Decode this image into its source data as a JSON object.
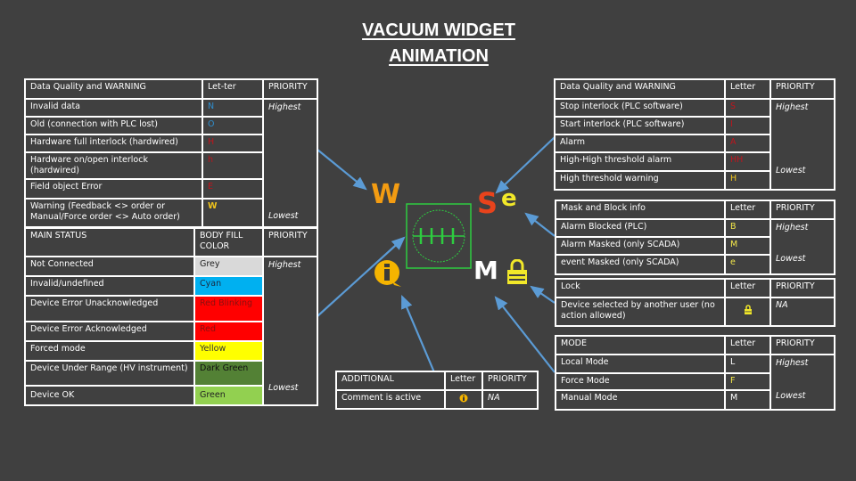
{
  "title_line1": "VACUUM WIDGET",
  "title_line2": "ANIMATION",
  "data_quality_left": {
    "headers": [
      "Data Quality and WARNING",
      "Let-ter",
      "PRIORITY"
    ],
    "priority_high": "Highest",
    "priority_low": "Lowest",
    "rows": [
      {
        "label": "Invalid data",
        "letter": "N",
        "color": "#2f8fcf"
      },
      {
        "label": "Old (connection with PLC lost)",
        "letter": "O",
        "color": "#2f8fcf"
      },
      {
        "label": "Hardware full interlock (hardwired)",
        "letter": "H",
        "color": "#c0141c"
      },
      {
        "label": "Hardware on/open interlock (hardwired)",
        "letter": "h",
        "color": "#c0141c"
      },
      {
        "label": "Field object Error",
        "letter": "E",
        "color": "#c0141c"
      },
      {
        "label": "Warning (Feedback <> order or Manual/Force order <> Auto order)",
        "letter": "W",
        "color": "#f0c41c"
      }
    ]
  },
  "main_status": {
    "headers": [
      "MAIN STATUS",
      "BODY FILL COLOR",
      "PRIORITY"
    ],
    "priority_high": "Highest",
    "priority_low": "Lowest",
    "rows": [
      {
        "label": "Not Connected",
        "fill": "Grey",
        "hex": "#d9d9d9"
      },
      {
        "label": "Invalid/undefined",
        "fill": "Cyan",
        "hex": "#00b0f0"
      },
      {
        "label": "Device Error Unacknowledged",
        "fill": "Red Blinking",
        "hex": "#ff0000"
      },
      {
        "label": "Device Error Acknowledged",
        "fill": "Red",
        "hex": "#ff0000"
      },
      {
        "label": "Forced mode",
        "fill": "Yellow",
        "hex": "#ffff00"
      },
      {
        "label": "Device Under Range (HV instrument)",
        "fill": "Dark Green",
        "hex": "#538135"
      },
      {
        "label": "Device OK",
        "fill": "Green",
        "hex": "#92d050"
      }
    ]
  },
  "data_quality_right": {
    "headers": [
      "Data Quality and WARNING",
      "Letter",
      "PRIORITY"
    ],
    "priority_high": "Highest",
    "priority_low": "Lowest",
    "rows": [
      {
        "label": "Stop interlock (PLC software)",
        "letter": "S",
        "color": "#c0141c"
      },
      {
        "label": "Start interlock (PLC software)",
        "letter": "I",
        "color": "#c0141c"
      },
      {
        "label": "Alarm",
        "letter": "A",
        "color": "#c0141c"
      },
      {
        "label": "High-High threshold alarm",
        "letter": "HH",
        "color": "#c0141c"
      },
      {
        "label": "High threshold warning",
        "letter": "H",
        "color": "#f0c41c"
      }
    ]
  },
  "mask_block": {
    "headers": [
      "Mask and Block info",
      "Letter",
      "PRIORITY"
    ],
    "priority_high": "Highest",
    "priority_low": "Lowest",
    "rows": [
      {
        "label": "Alarm Blocked (PLC)",
        "letter": "B",
        "color": "#f4e84a"
      },
      {
        "label": "Alarm Masked (only SCADA)",
        "letter": "M",
        "color": "#f4e84a"
      },
      {
        "label": "event Masked (only SCADA)",
        "letter": "e",
        "color": "#f4e84a"
      }
    ]
  },
  "lock": {
    "headers": [
      "Lock",
      "Letter",
      "PRIORITY"
    ],
    "rows": [
      {
        "label": "Device selected by another user (no action allowed)",
        "letter_icon": "lock-icon",
        "priority": "NA"
      }
    ]
  },
  "mode": {
    "headers": [
      "MODE",
      "Letter",
      "PRIORITY"
    ],
    "priority_high": "Highest",
    "priority_low": "Lowest",
    "rows": [
      {
        "label": "Local Mode",
        "letter": "L",
        "color": "#ffffff"
      },
      {
        "label": "Force Mode",
        "letter": "F",
        "color": "#f4e84a"
      },
      {
        "label": "Manual Mode",
        "letter": "M",
        "color": "#ffffff"
      }
    ]
  },
  "additional": {
    "headers": [
      "ADDITIONAL",
      "Letter",
      "PRIORITY"
    ],
    "rows": [
      {
        "label": "Comment is active",
        "letter_icon": "info-comment-icon",
        "priority": "NA"
      }
    ]
  },
  "widget": {
    "letter_w": "W",
    "letter_s": "S",
    "letter_e": "e",
    "letter_m": "M",
    "colors": {
      "w": "#f39c12",
      "s": "#e8431c",
      "e": "#f2e829",
      "m": "#ffffff",
      "body_outline": "#2ecc40",
      "info": "#f5b400",
      "lock": "#f2e829",
      "arrow": "#5b9bd5"
    }
  }
}
